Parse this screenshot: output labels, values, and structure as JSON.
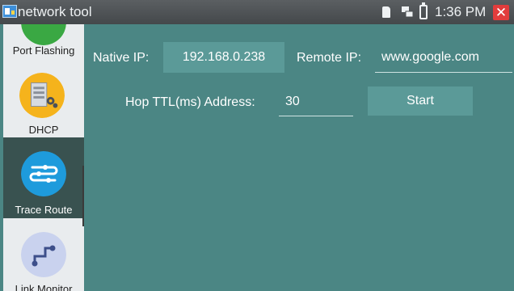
{
  "statusbar": {
    "app_title": "network tool",
    "time": "1:36 PM",
    "close_glyph": "✕",
    "icons": [
      "app-icon",
      "sd-card-icon",
      "network-icon",
      "battery-icon",
      "close-icon"
    ]
  },
  "sidebar": {
    "items": [
      {
        "label": "Port Flashing",
        "icon": "port-flashing-icon",
        "icon_color": "#3aa843"
      },
      {
        "label": "DHCP",
        "icon": "dhcp-icon",
        "icon_color": "#f5b31c"
      },
      {
        "label": "Trace Route",
        "icon": "trace-route-icon",
        "icon_color": "#1e9bdc",
        "selected": true
      },
      {
        "label": "Link Monitor",
        "icon": "link-monitor-icon",
        "icon_color": "#c9d2ee"
      }
    ]
  },
  "form": {
    "native_ip_label": "Native IP:",
    "native_ip_value": "192.168.0.238",
    "remote_ip_label": "Remote IP:",
    "remote_ip_value": "www.google.com",
    "hop_label": "Hop TTL(ms) Address:",
    "hop_value": "30",
    "start_label": "Start"
  },
  "colors": {
    "background": "#4b8684",
    "button": "#5b9a98",
    "statusbar": "#4f5356",
    "sidebar": "#e9ecee",
    "sidebar_selected": "#395250",
    "close": "#e23c3c"
  }
}
